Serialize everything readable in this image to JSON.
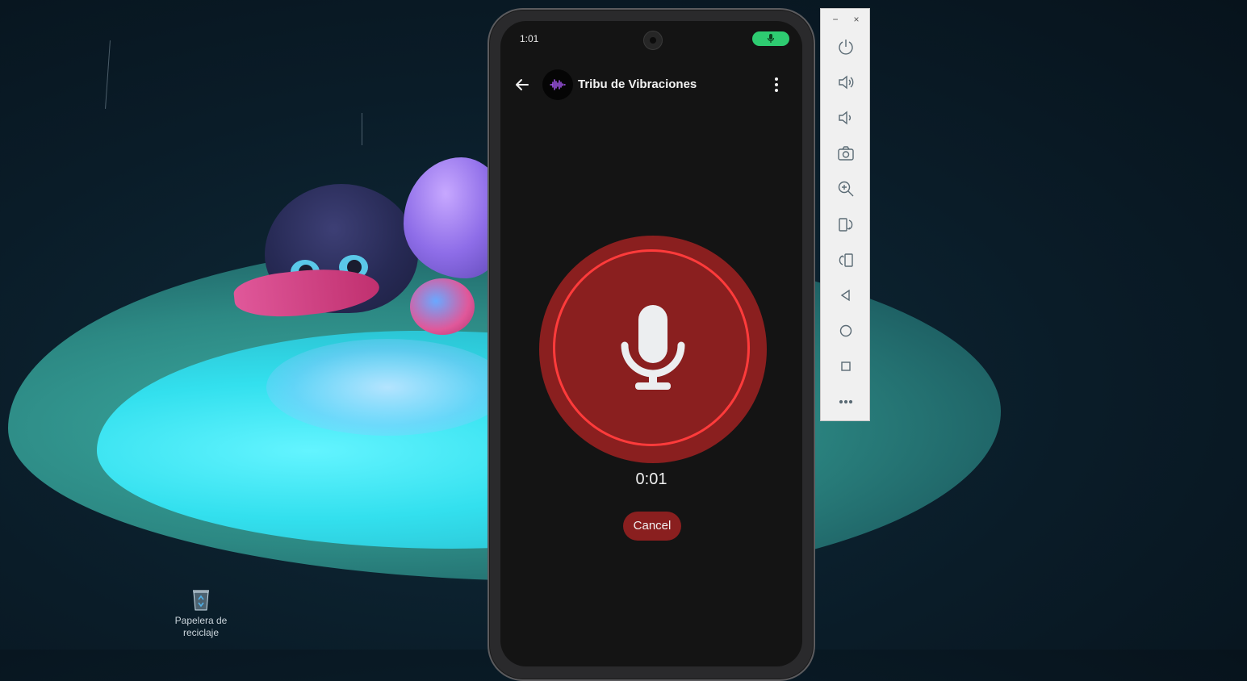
{
  "desktop": {
    "recycle_bin_label": "Papelera de reciclaje"
  },
  "phone": {
    "status_bar": {
      "time": "1:01",
      "mic_indicator_color": "#2ecc71"
    },
    "app_bar": {
      "title": "Tribu de Vibraciones",
      "back_icon": "arrow-back-icon",
      "avatar_icon": "waveform-icon",
      "menu_icon": "more-vert-icon"
    },
    "recording": {
      "timer": "0:01",
      "cancel_label": "Cancel",
      "accent_color": "#8a1f1f",
      "ring_color": "#ff3b3b"
    }
  },
  "emulator_toolbar": {
    "window_buttons": [
      "−",
      "×"
    ],
    "buttons": [
      {
        "icon": "power-icon"
      },
      {
        "icon": "volume-up-icon"
      },
      {
        "icon": "volume-down-icon"
      },
      {
        "icon": "camera-icon"
      },
      {
        "icon": "zoom-icon"
      },
      {
        "icon": "rotate-left-icon"
      },
      {
        "icon": "rotate-right-icon"
      },
      {
        "icon": "back-triangle-icon"
      },
      {
        "icon": "home-circle-icon"
      },
      {
        "icon": "overview-square-icon"
      },
      {
        "icon": "more-horiz-icon"
      }
    ]
  }
}
